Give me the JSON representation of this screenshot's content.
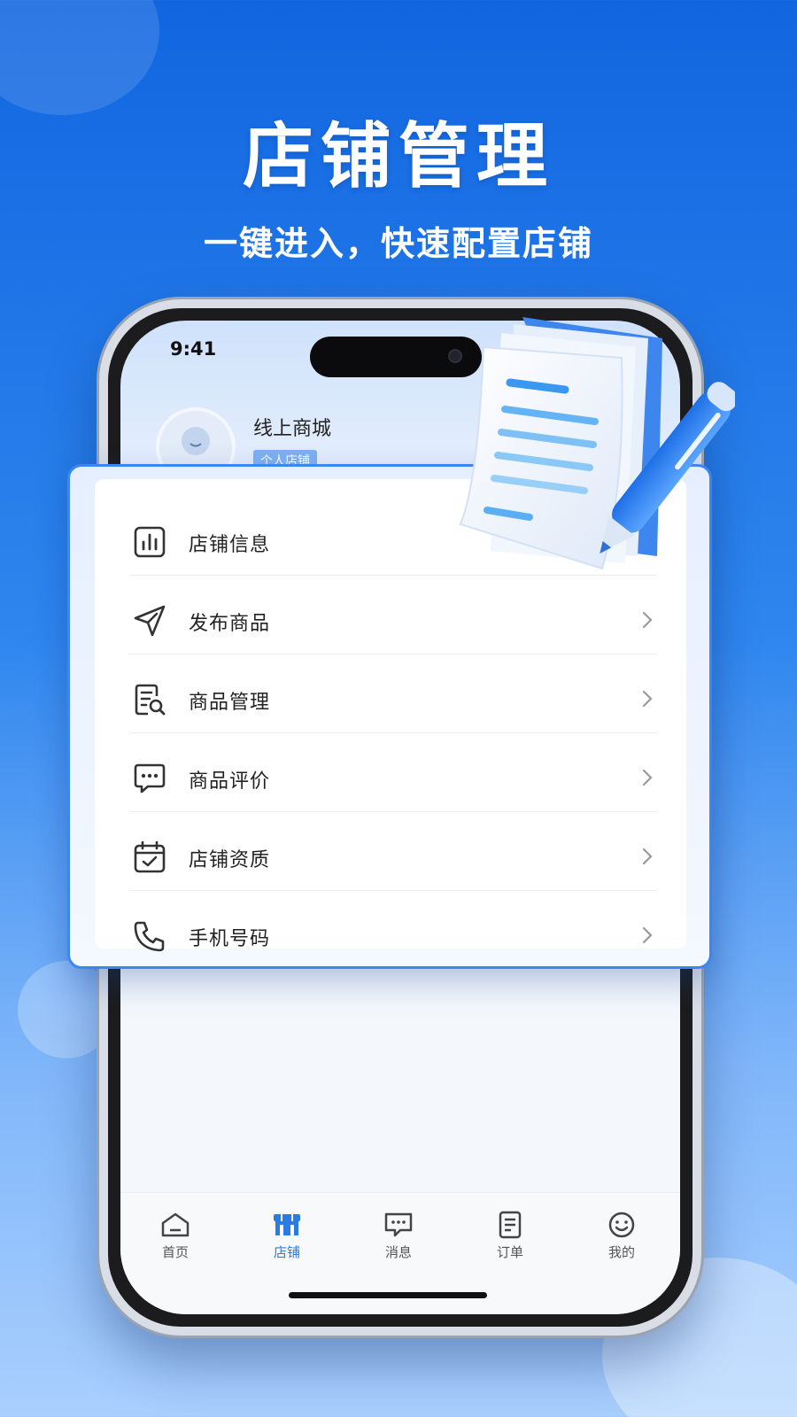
{
  "promo": {
    "headline": "店铺管理",
    "subheadline": "一键进入，快速配置店铺"
  },
  "status_bar": {
    "time": "9:41"
  },
  "profile": {
    "shop_name": "线上商城",
    "shop_type": "个人店铺"
  },
  "menu": {
    "items": [
      {
        "label": "店铺信息",
        "icon": "chart-icon",
        "has_chevron": false
      },
      {
        "label": "发布商品",
        "icon": "send-icon",
        "has_chevron": true
      },
      {
        "label": "商品管理",
        "icon": "document-search-icon",
        "has_chevron": true
      },
      {
        "label": "商品评价",
        "icon": "chat-bubble-icon",
        "has_chevron": true
      },
      {
        "label": "店铺资质",
        "icon": "calendar-check-icon",
        "has_chevron": true
      },
      {
        "label": "手机号码",
        "icon": "phone-icon",
        "has_chevron": true
      }
    ]
  },
  "tabbar": {
    "tabs": [
      {
        "label": "首页",
        "icon": "home-icon",
        "active": false
      },
      {
        "label": "店铺",
        "icon": "store-icon",
        "active": true
      },
      {
        "label": "消息",
        "icon": "message-icon",
        "active": false
      },
      {
        "label": "订单",
        "icon": "order-icon",
        "active": false
      },
      {
        "label": "我的",
        "icon": "smile-icon",
        "active": false
      }
    ]
  },
  "colors": {
    "accent": "#2a7be4",
    "card_border": "#3b86ef",
    "background_top": "#1166e0",
    "background_bottom": "#a9cffd"
  }
}
